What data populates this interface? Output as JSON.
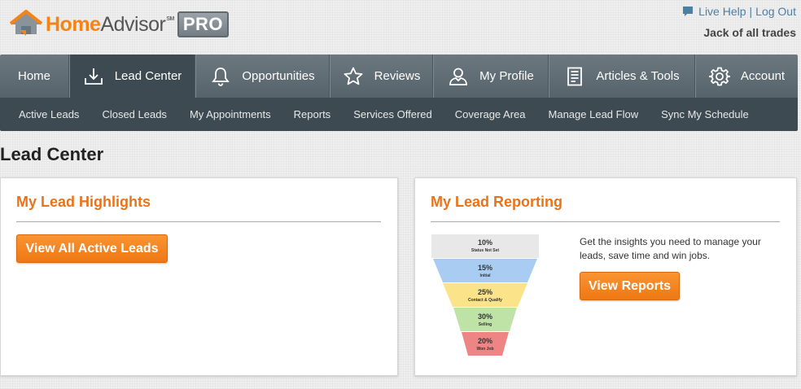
{
  "brand": {
    "home": "Home",
    "advisor": "Advisor",
    "sm": "SM",
    "pro": "PRO"
  },
  "top_links": {
    "live_help": "Live Help",
    "separator": "|",
    "log_out": "Log Out",
    "user_name": "Jack of all trades"
  },
  "main_nav": [
    {
      "label": "Home",
      "icon": "none",
      "active": false
    },
    {
      "label": "Lead Center",
      "icon": "download-icon",
      "active": true
    },
    {
      "label": "Opportunities",
      "icon": "bell-icon",
      "active": false
    },
    {
      "label": "Reviews",
      "icon": "star-icon",
      "active": false
    },
    {
      "label": "My Profile",
      "icon": "person-icon",
      "active": false
    },
    {
      "label": "Articles & Tools",
      "icon": "document-icon",
      "active": false
    },
    {
      "label": "Account",
      "icon": "gear-icon",
      "active": false
    }
  ],
  "sub_nav": [
    "Active Leads",
    "Closed Leads",
    "My Appointments",
    "Reports",
    "Services Offered",
    "Coverage Area",
    "Manage Lead Flow",
    "Sync My Schedule"
  ],
  "page_title": "Lead Center",
  "highlights": {
    "title": "My Lead Highlights",
    "button": "View All Active Leads"
  },
  "reporting": {
    "title": "My Lead Reporting",
    "description": "Get the insights you need to manage your leads, save time and win jobs.",
    "button": "View Reports",
    "funnel": [
      {
        "pct": "10%",
        "label": "Status Not Set",
        "color": "#e8e8e8"
      },
      {
        "pct": "15%",
        "label": "Initial",
        "color": "#a9cdf2"
      },
      {
        "pct": "25%",
        "label": "Contact & Qualify",
        "color": "#fbe38a"
      },
      {
        "pct": "30%",
        "label": "Selling",
        "color": "#bfe3a7"
      },
      {
        "pct": "20%",
        "label": "Won Job",
        "color": "#ee8585"
      }
    ]
  },
  "colors": {
    "brand_orange": "#f68315",
    "nav_dark": "#3e4a51",
    "link_blue": "#4d7fa3"
  }
}
